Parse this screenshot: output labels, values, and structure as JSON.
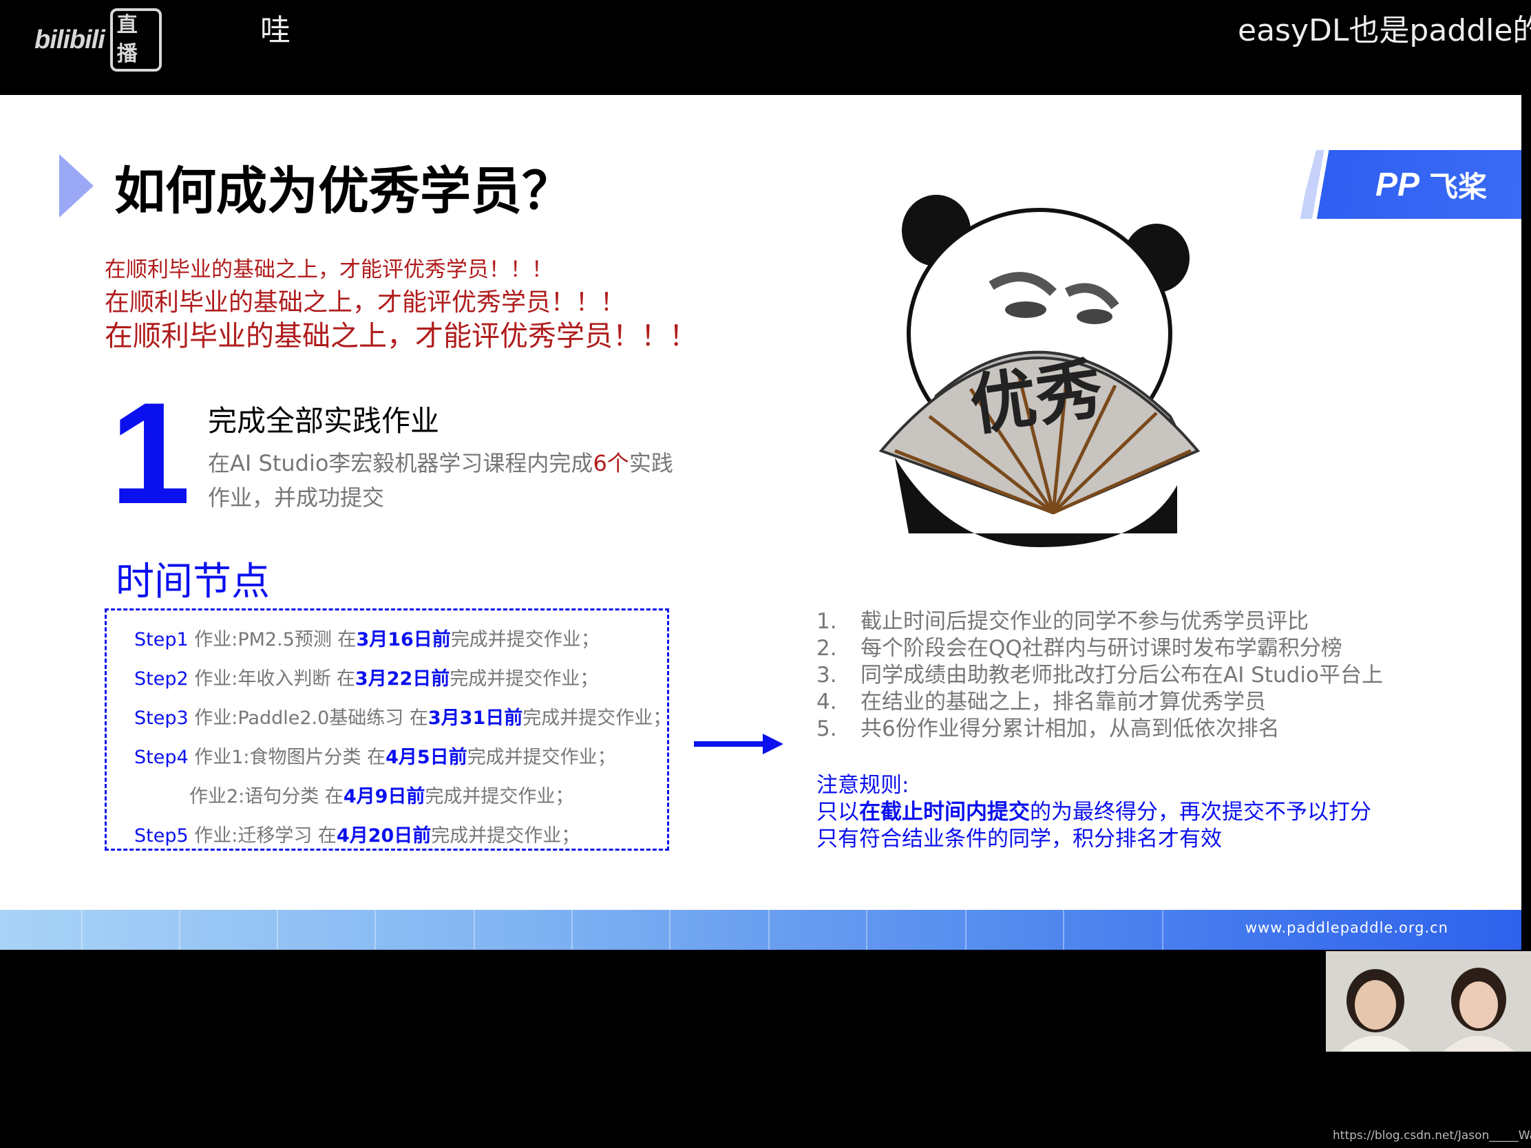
{
  "stream": {
    "logo": {
      "bili": "bilibili",
      "live": "直播"
    },
    "danmaku": [
      "哇",
      "easyDL也是paddle的"
    ]
  },
  "slide": {
    "title": "如何成为优秀学员？",
    "brand": {
      "mark": "PP",
      "name": "飞桨"
    },
    "warnings": [
      "在顺利毕业的基础之上，才能评优秀学员！！！",
      "在顺利毕业的基础之上，才能评优秀学员！！！",
      "在顺利毕业的基础之上，才能评优秀学员！！！"
    ],
    "task": {
      "number": "1",
      "title": "完成全部实践作业",
      "desc_pre": "在AI Studio李宏毅机器学习课程内完成",
      "desc_highlight": "6个",
      "desc_post": "实践作业，并成功提交"
    },
    "time_title": "时间节点",
    "steps": [
      {
        "label": "Step1",
        "text": " 作业:PM2.5预测 在",
        "deadline": "3月16日前",
        "suffix": "完成并提交作业；"
      },
      {
        "label": "Step2",
        "text": " 作业:年收入判断 在",
        "deadline": "3月22日前",
        "suffix": "完成并提交作业；"
      },
      {
        "label": "Step3",
        "text": " 作业:Paddle2.0基础练习 在",
        "deadline": "3月31日前",
        "suffix": "完成并提交作业；"
      },
      {
        "label": "Step4",
        "text": " 作业1:食物图片分类 在",
        "deadline": "4月5日前",
        "suffix": "完成并提交作业；"
      },
      {
        "label": "",
        "text": "作业2:语句分类 在",
        "deadline": "4月9日前",
        "suffix": "完成并提交作业；"
      },
      {
        "label": "Step5",
        "text": " 作业:迁移学习 在",
        "deadline": "4月20日前",
        "suffix": "完成并提交作业；"
      }
    ],
    "meme_text": "优秀",
    "rules": [
      {
        "num": "1.",
        "text": "截止时间后提交作业的同学不参与优秀学员评比"
      },
      {
        "num": "2.",
        "text": "每个阶段会在QQ社群内与研讨课时发布学霸积分榜"
      },
      {
        "num": "3.",
        "text": "同学成绩由助教老师批改打分后公布在AI Studio平台上"
      },
      {
        "num": "4.",
        "text": "在结业的基础之上，排名靠前才算优秀学员"
      },
      {
        "num": "5.",
        "text": "共6份作业得分累计相加，从高到低依次排名"
      }
    ],
    "note": {
      "head": "注意规则:",
      "line1_pre": "只以",
      "line1_bold": "在截止时间内提交",
      "line1_post": "的为最终得分，再次提交不予以打分",
      "line2": "只有符合结业条件的同学，积分排名才有效"
    },
    "footer_url": "www.paddlepaddle.org.cn"
  },
  "watermark": "https://blog.csdn.net/Jason_____Wang",
  "colors": {
    "accent_blue": "#0b10ee",
    "warn_red": "#b01c1c",
    "footer_blue": "#2e62ec"
  }
}
